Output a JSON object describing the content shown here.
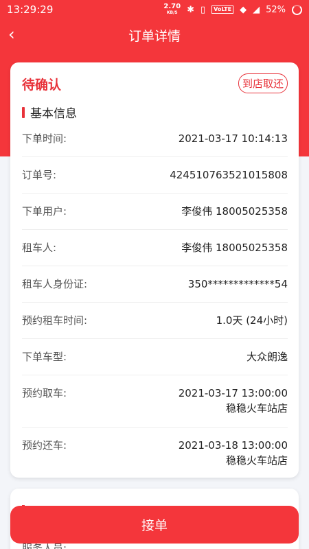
{
  "status_bar": {
    "time": "13:29:29",
    "speed_value": "2.70",
    "speed_unit": "KB/S",
    "volte": "VoLTE",
    "battery": "52%"
  },
  "nav": {
    "back": "‹",
    "title": "订单详情"
  },
  "order": {
    "status": "待确认",
    "tag": "到店取还",
    "section_title": "基本信息",
    "rows": [
      {
        "label": "下单时间:",
        "value": "2021-03-17 10:14:13"
      },
      {
        "label": "订单号:",
        "value": "424510763521015808"
      },
      {
        "label": "下单用户:",
        "value": "李俊伟  18005025358"
      },
      {
        "label": "租车人:",
        "value": "李俊伟  18005025358"
      },
      {
        "label": "租车人身份证:",
        "value": "350*************54"
      },
      {
        "label": "预约租车时间:",
        "value": "1.0天 (24小时)"
      },
      {
        "label": "下单车型:",
        "value": "大众朗逸"
      },
      {
        "label": "预约取车:",
        "value": "2021-03-17 13:00:00",
        "value2": "稳稳火车站店"
      },
      {
        "label": "预约还车:",
        "value": "2021-03-18 13:00:00",
        "value2": "稳稳火车站店"
      }
    ]
  },
  "second_card": {
    "row_label": "服务人员:"
  },
  "accept_button": "接单"
}
